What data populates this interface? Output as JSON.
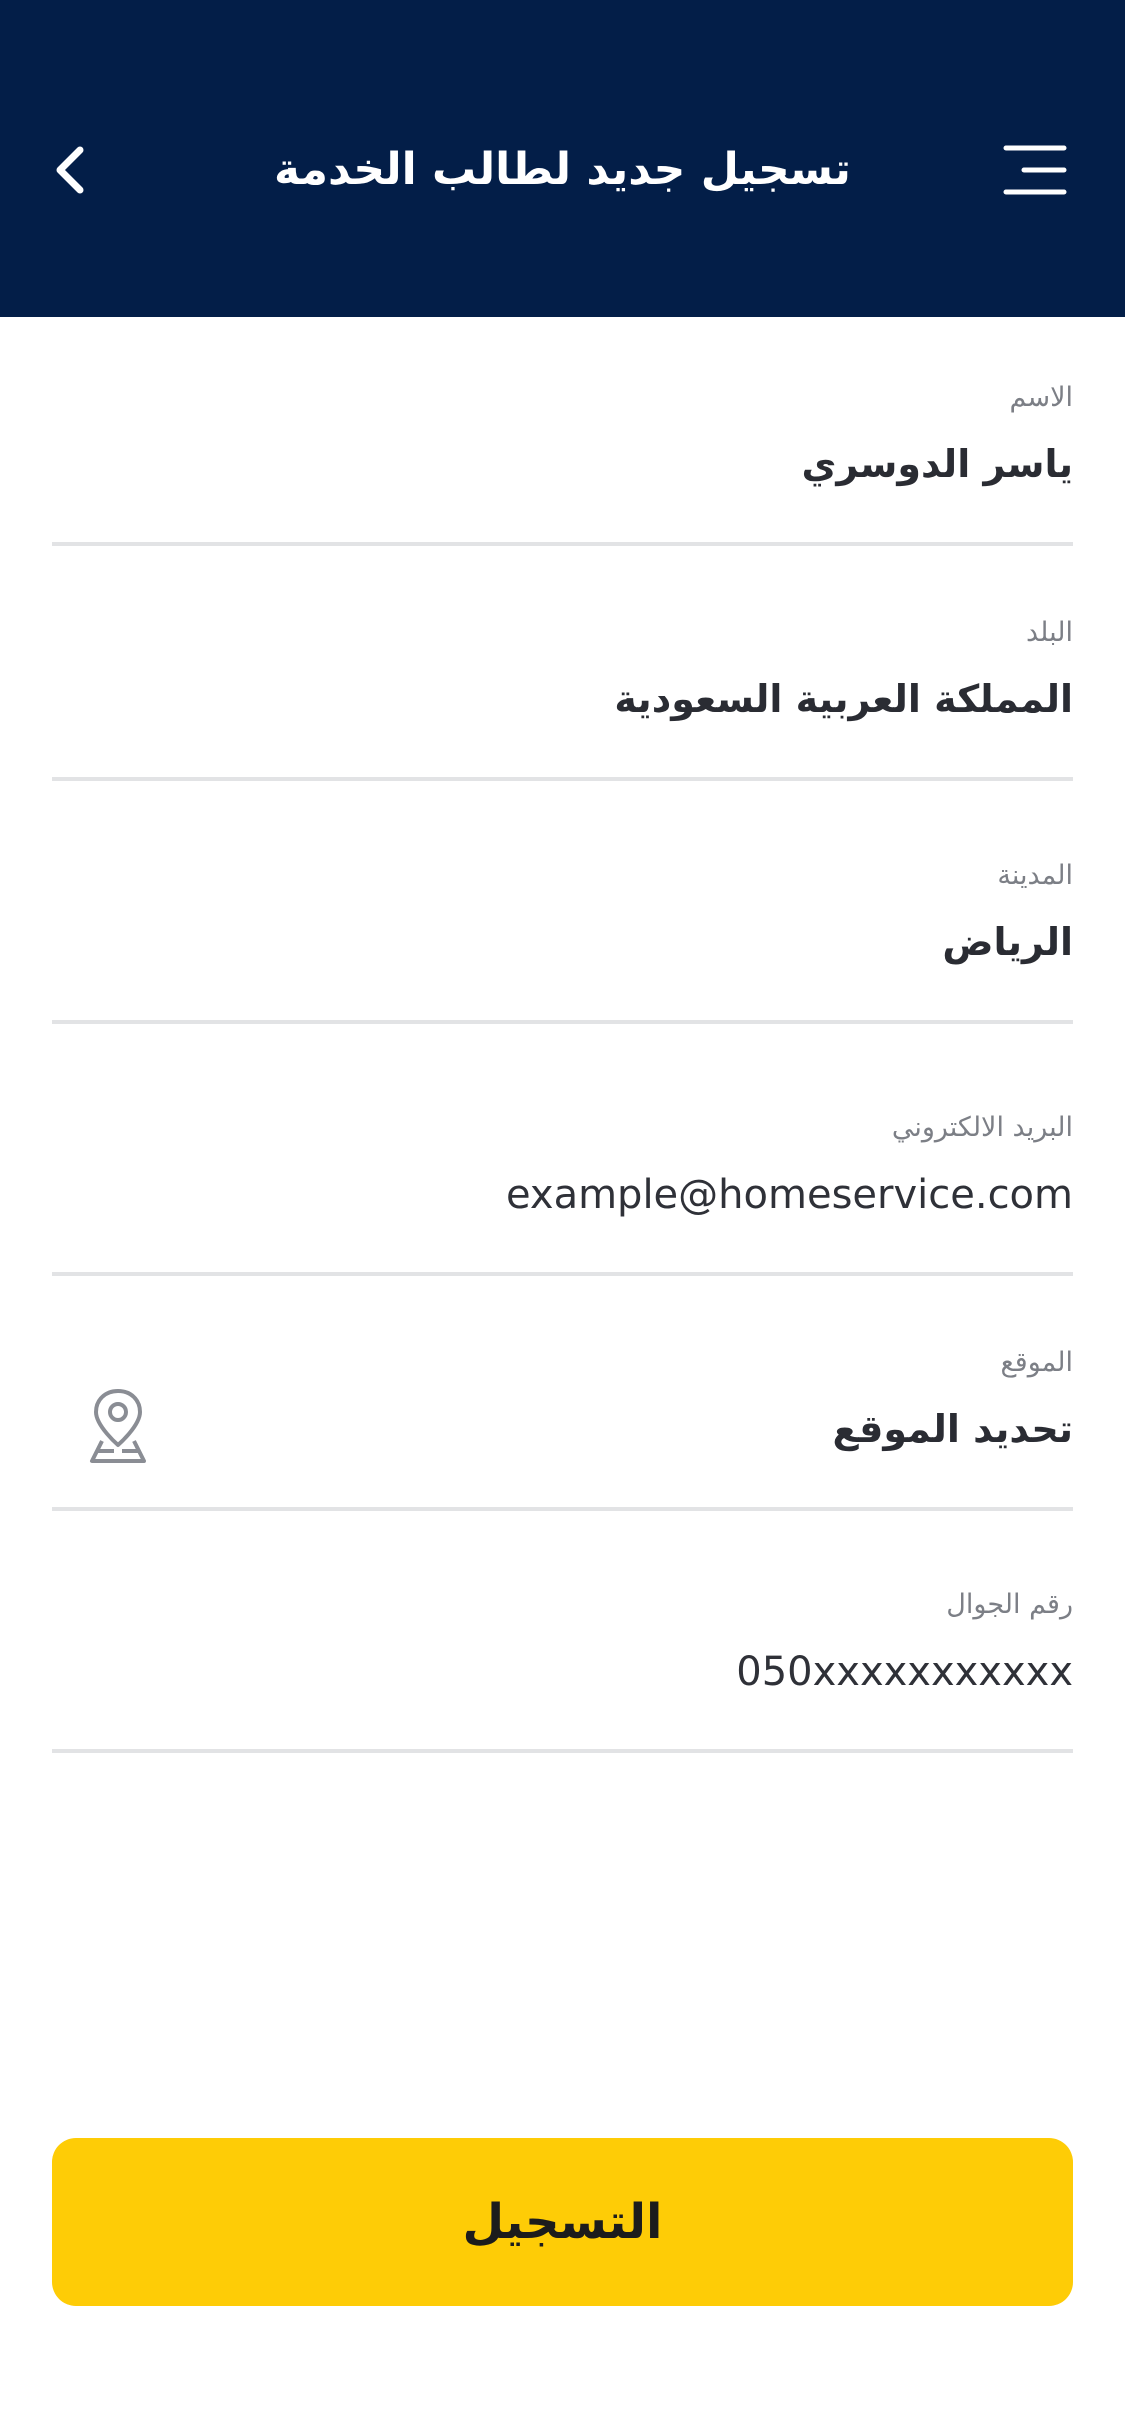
{
  "header": {
    "title": "تسجيل جديد لطالب الخدمة",
    "back_icon": "chevron-left-icon",
    "menu_icon": "hamburger-menu-icon",
    "background": "#031e48"
  },
  "form": {
    "name": {
      "label": "الاسم",
      "value": "ياسر الدوسري"
    },
    "country": {
      "label": "البلد",
      "value": "المملكة العربية السعودية"
    },
    "city": {
      "label": "المدينة",
      "value": "الرياض"
    },
    "email": {
      "label": "البريد الالكتروني",
      "value": "example@homeservice.com"
    },
    "location": {
      "label": "الموقع",
      "value": "تحديد الموقع",
      "icon": "map-pin-icon"
    },
    "phone": {
      "label": "رقم الجوال",
      "value": "050xxxxxxxxxxx"
    }
  },
  "submit": {
    "label": "التسجيل",
    "color": "#fecc06"
  }
}
